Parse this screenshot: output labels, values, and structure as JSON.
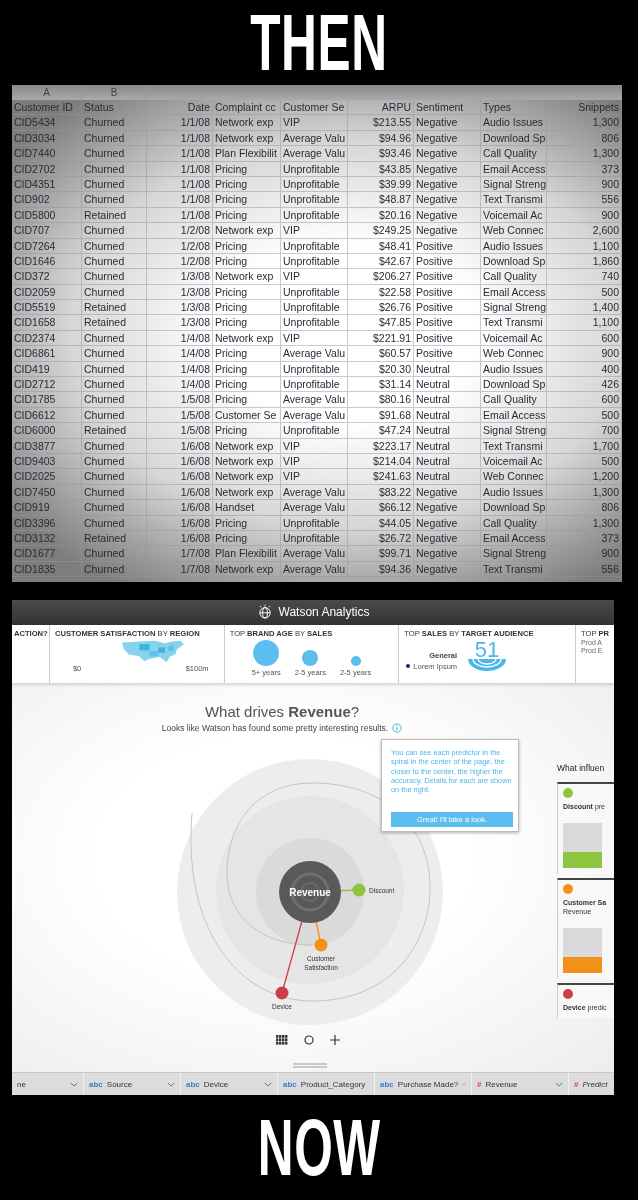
{
  "top_caption": "THEN",
  "spreadsheet": {
    "column_letters": [
      "A",
      "B"
    ],
    "columns": [
      "Customer ID",
      "Status",
      "Date",
      "Complaint cc",
      "Customer Se",
      "ARPU",
      "Sentiment",
      "Types",
      "Snippets"
    ],
    "rows": [
      [
        "CID5434",
        "Churned",
        "1/1/08",
        "Network exp",
        "VIP",
        "$213.55",
        "Negative",
        "Audio Issues",
        "1,300"
      ],
      [
        "CID3034",
        "Churned",
        "1/1/08",
        "Network exp",
        "Average Valu",
        "$94.96",
        "Negative",
        "Download Sp",
        "806"
      ],
      [
        "CID7440",
        "Churned",
        "1/1/08",
        "Plan Flexibilit",
        "Average Valu",
        "$93.46",
        "Negative",
        "Call Quality",
        "1,300"
      ],
      [
        "CID2702",
        "Churned",
        "1/1/08",
        "Pricing",
        "Unprofitable",
        "$43.85",
        "Negative",
        "Email Access",
        "373"
      ],
      [
        "CID4351",
        "Churned",
        "1/1/08",
        "Pricing",
        "Unprofitable",
        "$39.99",
        "Negative",
        "Signal Streng",
        "900"
      ],
      [
        "CID902",
        "Churned",
        "1/1/08",
        "Pricing",
        "Unprofitable",
        "$48.87",
        "Negative",
        "Text Transmi",
        "556"
      ],
      [
        "CID5800",
        "Retained",
        "1/1/08",
        "Pricing",
        "Unprofitable",
        "$20.16",
        "Negative",
        "Voicemail Ac",
        "900"
      ],
      [
        "CID707",
        "Churned",
        "1/2/08",
        "Network exp",
        "VIP",
        "$249.25",
        "Negative",
        "Web Connec",
        "2,600"
      ],
      [
        "CID7264",
        "Churned",
        "1/2/08",
        "Pricing",
        "Unprofitable",
        "$48.41",
        "Positive",
        "Audio Issues",
        "1,100"
      ],
      [
        "CID1646",
        "Churned",
        "1/2/08",
        "Pricing",
        "Unprofitable",
        "$42.67",
        "Positive",
        "Download Sp",
        "1,860"
      ],
      [
        "CID372",
        "Churned",
        "1/3/08",
        "Network exp",
        "VIP",
        "$206.27",
        "Positive",
        "Call Quality",
        "740"
      ],
      [
        "CID2059",
        "Churned",
        "1/3/08",
        "Pricing",
        "Unprofitable",
        "$22.58",
        "Positive",
        "Email Access",
        "500"
      ],
      [
        "CID5519",
        "Retained",
        "1/3/08",
        "Pricing",
        "Unprofitable",
        "$26.76",
        "Positive",
        "Signal Streng",
        "1,400"
      ],
      [
        "CID1658",
        "Retained",
        "1/3/08",
        "Pricing",
        "Unprofitable",
        "$47.85",
        "Positive",
        "Text Transmi",
        "1,100"
      ],
      [
        "CID2374",
        "Churned",
        "1/4/08",
        "Network exp",
        "VIP",
        "$221.91",
        "Positive",
        "Voicemail Ac",
        "600"
      ],
      [
        "CID6861",
        "Churned",
        "1/4/08",
        "Pricing",
        "Average Valu",
        "$60.57",
        "Positive",
        "Web Connec",
        "900"
      ],
      [
        "CID419",
        "Churned",
        "1/4/08",
        "Pricing",
        "Unprofitable",
        "$20.30",
        "Neutral",
        "Audio Issues",
        "400"
      ],
      [
        "CID2712",
        "Churned",
        "1/4/08",
        "Pricing",
        "Unprofitable",
        "$31.14",
        "Neutral",
        "Download Sp",
        "426"
      ],
      [
        "CID1785",
        "Churned",
        "1/5/08",
        "Pricing",
        "Average Valu",
        "$80.16",
        "Neutral",
        "Call Quality",
        "600"
      ],
      [
        "CID6612",
        "Churned",
        "1/5/08",
        "Customer Se",
        "Average Valu",
        "$91.68",
        "Neutral",
        "Email Access",
        "500"
      ],
      [
        "CID6000",
        "Retained",
        "1/5/08",
        "Pricing",
        "Unprofitable",
        "$47.24",
        "Neutral",
        "Signal Streng",
        "700"
      ],
      [
        "CID3877",
        "Churned",
        "1/6/08",
        "Network exp",
        "VIP",
        "$223.17",
        "Neutral",
        "Text Transmi",
        "1,700"
      ],
      [
        "CID9403",
        "Churned",
        "1/6/08",
        "Network exp",
        "VIP",
        "$214.04",
        "Neutral",
        "Voicemail Ac",
        "500"
      ],
      [
        "CID2025",
        "Churned",
        "1/6/08",
        "Network exp",
        "VIP",
        "$241.63",
        "Neutral",
        "Web Connec",
        "1,200"
      ],
      [
        "CID7450",
        "Churned",
        "1/6/08",
        "Network exp",
        "Average Valu",
        "$83.22",
        "Negative",
        "Audio Issues",
        "1,300"
      ],
      [
        "CID919",
        "Churned",
        "1/6/08",
        "Handset",
        "Average Valu",
        "$66.12",
        "Negative",
        "Download Sp",
        "806"
      ],
      [
        "CID3396",
        "Churned",
        "1/6/08",
        "Pricing",
        "Unprofitable",
        "$44.05",
        "Negative",
        "Call Quality",
        "1,300"
      ],
      [
        "CID3132",
        "Retained",
        "1/6/08",
        "Pricing",
        "Unprofitable",
        "$26.72",
        "Negative",
        "Email Access",
        "373"
      ],
      [
        "CID1677",
        "Churned",
        "1/7/08",
        "Plan Flexibilit",
        "Average Valu",
        "$99.71",
        "Negative",
        "Signal Streng",
        "900"
      ],
      [
        "CID1835",
        "Churned",
        "1/7/08",
        "Network exp",
        "Average Valu",
        "$94.36",
        "Negative",
        "Text Transmi",
        "556"
      ]
    ]
  },
  "watson": {
    "app_title": "Watson Analytics",
    "tiles": [
      {
        "kind": "cut",
        "title": "ACTION?"
      },
      {
        "kind": "map",
        "title": "**CUSTOMER SATISFACTION** BY **REGION**",
        "min_label": "$0",
        "max_label": "$100m"
      },
      {
        "kind": "bubbles",
        "title": "TOP **BRAND AGE** BY **SALES**",
        "labels": [
          "5+ years",
          "2-5 years",
          "2-5 years"
        ]
      },
      {
        "kind": "audience",
        "title": "TOP **SALES** BY **TARGET AUDIENCE**",
        "segment": "General",
        "legend": "Lorem Ipsum",
        "value": "51"
      },
      {
        "kind": "list",
        "title": "TOP **PR**",
        "items": [
          "Prod A",
          "Prod E"
        ]
      }
    ],
    "heading": "What drives **Revenue**?",
    "subtitle": "Looks like Watson has found some pretty interesting results.",
    "tooltip": {
      "text": "You can see each predictor in the spiral in the center of the page, the closer to the center, the higher the accuracy. Details for each are shown on the right.",
      "button": "Great! I'll take a look."
    },
    "target": "Revenue",
    "predictors": [
      {
        "name": "Discount",
        "color": "#8cc63f"
      },
      {
        "name": "Customer Satisfaction",
        "color": "#f39019"
      },
      {
        "name": "Device",
        "color": "#cc3f4a"
      }
    ],
    "panel": {
      "title": "What influen",
      "cards": [
        {
          "text": "**Discount** pre",
          "color": "#8cc63f",
          "level": 0.35
        },
        {
          "text": "**Customer Sa**\nRevenue",
          "color": "#f39019",
          "level": 0.35
        },
        {
          "text": "**Device** predic",
          "color": "#cc3f4a"
        }
      ]
    },
    "columns": [
      {
        "kind": "plain",
        "name": "ne",
        "truncated": false
      },
      {
        "kind": "text",
        "type_label": "abc",
        "name": "Source",
        "truncated": false
      },
      {
        "kind": "text",
        "type_label": "abc",
        "name": "Device",
        "truncated": false
      },
      {
        "kind": "text",
        "type_label": "abc",
        "name": "Product_Category",
        "truncated": false
      },
      {
        "kind": "text",
        "type_label": "abc",
        "name": "Purchase Made?",
        "truncated": false
      },
      {
        "kind": "number",
        "type_label": "#",
        "name": "Revenue",
        "truncated": false
      },
      {
        "kind": "number",
        "type_label": "#",
        "name": "Predict",
        "truncated": true
      }
    ]
  },
  "bottom_caption": "NOW"
}
